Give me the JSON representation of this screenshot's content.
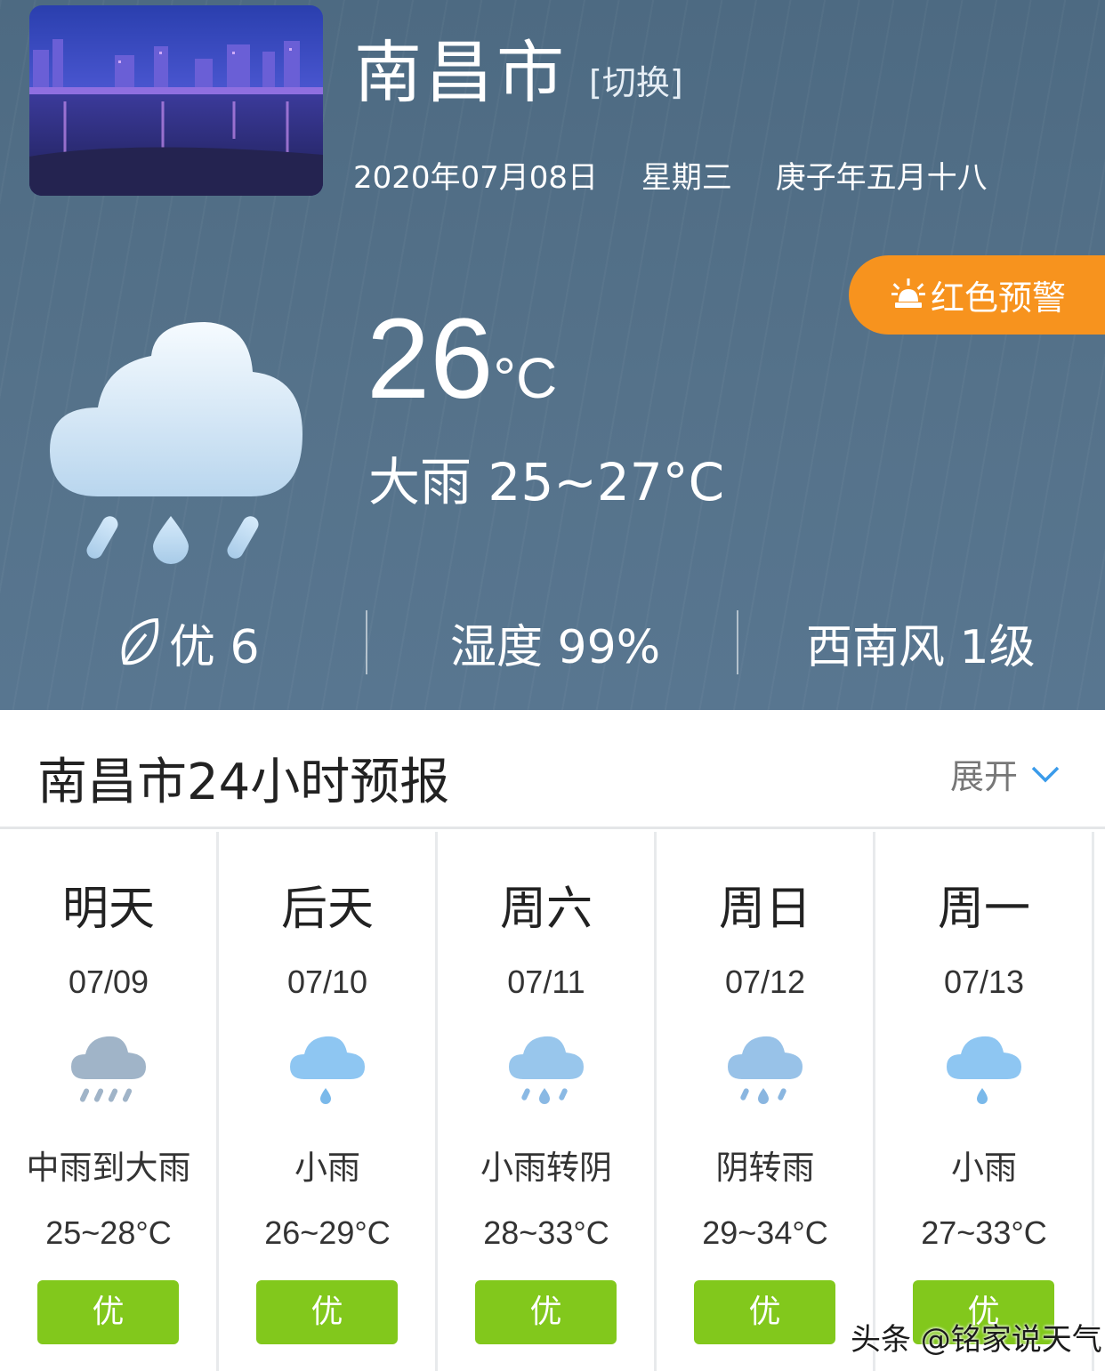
{
  "header": {
    "city": "南昌市",
    "switch_label": "[切换]",
    "date": "2020年07月08日",
    "weekday": "星期三",
    "lunar": "庚子年五月十八"
  },
  "alert": {
    "label": "红色预警",
    "icon": "alarm-light-icon",
    "color": "#f7931e"
  },
  "current": {
    "temp": "26",
    "unit": "°C",
    "condition": "大雨 25~27°C",
    "icon": "heavy-rain-cloud-icon"
  },
  "stats": {
    "aqi": "优 6",
    "aqi_icon": "leaf-icon",
    "humidity": "湿度 99%",
    "wind": "西南风 1级"
  },
  "forecast": {
    "title": "南昌市24小时预报",
    "expand_label": "展开",
    "days": [
      {
        "name": "明天",
        "date": "07/09",
        "desc": "中雨到大雨",
        "range": "25~28°C",
        "aqi": "优",
        "icon": "moderate-to-heavy-rain-icon"
      },
      {
        "name": "后天",
        "date": "07/10",
        "desc": "小雨",
        "range": "26~29°C",
        "aqi": "优",
        "icon": "light-rain-icon"
      },
      {
        "name": "周六",
        "date": "07/11",
        "desc": "小雨转阴",
        "range": "28~33°C",
        "aqi": "优",
        "icon": "light-rain-icon"
      },
      {
        "name": "周日",
        "date": "07/12",
        "desc": "阴转雨",
        "range": "29~34°C",
        "aqi": "优",
        "icon": "rain-icon"
      },
      {
        "name": "周一",
        "date": "07/13",
        "desc": "小雨",
        "range": "27~33°C",
        "aqi": "优",
        "icon": "light-rain-icon"
      }
    ]
  },
  "colors": {
    "panel": "#55728a",
    "aqi_good": "#82c81c",
    "alert": "#f7931e"
  },
  "watermark": "头条 @铭家说天气"
}
